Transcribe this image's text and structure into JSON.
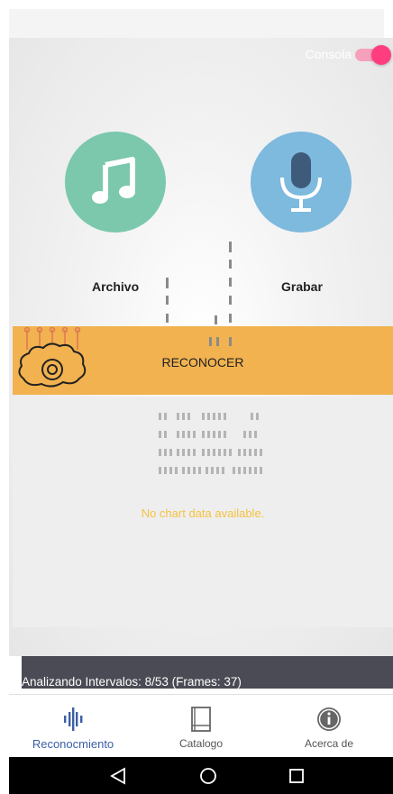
{
  "header": {
    "console_label": "Consola",
    "console_on": true
  },
  "actions": {
    "archivo_label": "Archivo",
    "grabar_label": "Grabar"
  },
  "reconocer": {
    "label": "RECONOCER"
  },
  "chart": {
    "empty_message": "No chart data available."
  },
  "status": {
    "analyzing_text": "Analizando Intervalos: 8/53 (Frames: 37)"
  },
  "bottom_nav": {
    "items": [
      {
        "label": "Reconocmiento",
        "icon": "waveform-icon",
        "active": true
      },
      {
        "label": "Catalogo",
        "icon": "book-icon",
        "active": false
      },
      {
        "label": "Acerca de",
        "icon": "info-icon",
        "active": false
      }
    ]
  },
  "colors": {
    "archivo": "#7bc8ad",
    "grabar": "#7eb9de",
    "reconocer": "#f1b24f",
    "toggle": "#ff3d7f",
    "active_nav": "#3b5fa6",
    "empty_message": "#f5c242"
  }
}
